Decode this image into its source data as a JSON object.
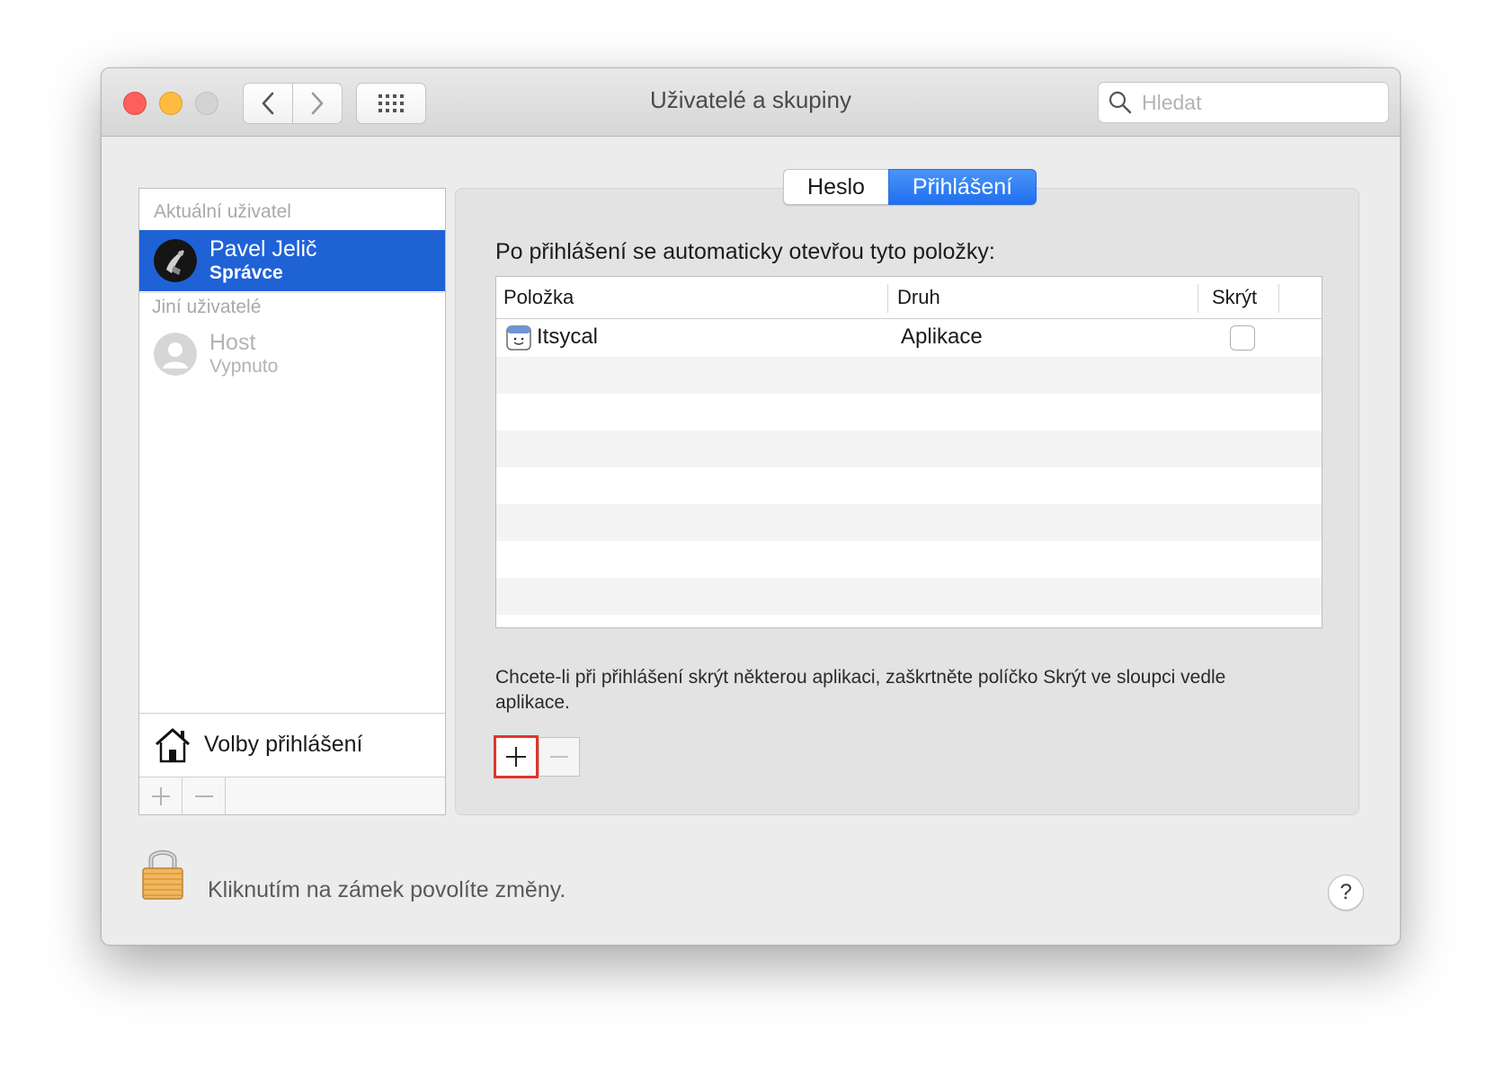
{
  "window": {
    "title": "Uživatelé a skupiny"
  },
  "search": {
    "placeholder": "Hledat"
  },
  "sidebar": {
    "current_header": "Aktuální uživatel",
    "current_user": {
      "name": "Pavel Jelič",
      "role": "Správce"
    },
    "other_header": "Jiní uživatelé",
    "other_users": [
      {
        "name": "Host",
        "status": "Vypnuto"
      }
    ],
    "login_options": "Volby přihlášení"
  },
  "tabs": [
    {
      "label": "Heslo",
      "active": false
    },
    {
      "label": "Přihlášení",
      "active": true
    }
  ],
  "login_items": {
    "heading": "Po přihlášení se automaticky otevřou tyto položky:",
    "columns": {
      "item": "Položka",
      "kind": "Druh",
      "hide": "Skrýt"
    },
    "rows": [
      {
        "item": "Itsycal",
        "kind": "Aplikace",
        "hidden": false
      }
    ],
    "hint": "Chcete-li při přihlášení skrýt některou aplikaci, zaškrtněte políčko Skrýt ve sloupci vedle aplikace."
  },
  "footer": {
    "lock_text": "Kliknutím na zámek povolíte změny.",
    "help": "?"
  },
  "colors": {
    "selection": "#1f62d6",
    "tab_active": "#2a79f0",
    "highlight_border": "#e2342a"
  }
}
